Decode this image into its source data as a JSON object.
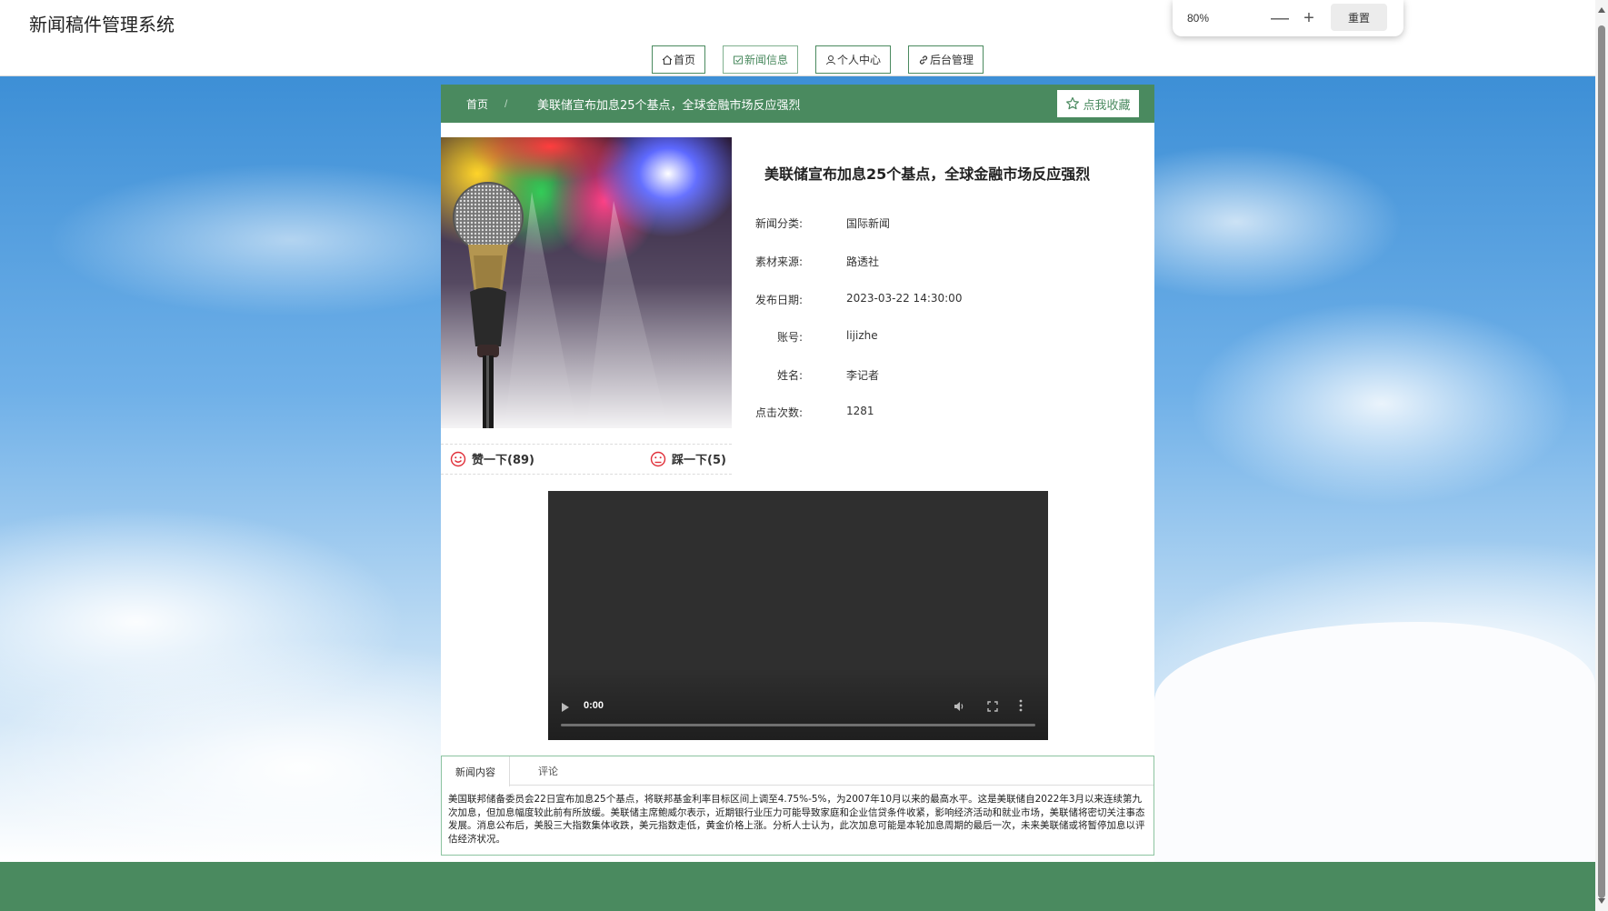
{
  "header": {
    "site_title": "新闻稿件管理系统",
    "nav": [
      {
        "label": "首页",
        "icon": "home-icon"
      },
      {
        "label": "新闻信息",
        "icon": "news-icon"
      },
      {
        "label": "个人中心",
        "icon": "user-icon"
      },
      {
        "label": "后台管理",
        "icon": "link-icon"
      }
    ]
  },
  "zoom": {
    "value": "80%",
    "minus": "—",
    "plus": "+",
    "reset_label": "重置"
  },
  "breadcrumb": {
    "home": "首页",
    "separator": "/",
    "current": "美联储宣布加息25个基点，全球金融市场反应强烈"
  },
  "favorite": {
    "label": "点我收藏",
    "icon": "star-icon"
  },
  "news": {
    "title": "美联储宣布加息25个基点，全球金融市场反应强烈",
    "fields": [
      {
        "label": "新闻分类:",
        "value": "国际新闻"
      },
      {
        "label": "素材来源:",
        "value": "路透社"
      },
      {
        "label": "发布日期:",
        "value": "2023-03-22 14:30:00"
      },
      {
        "label": "账号:",
        "value": "lijizhe"
      },
      {
        "label": "姓名:",
        "value": "李记者"
      },
      {
        "label": "点击次数:",
        "value": "1281"
      }
    ],
    "like_label": "赞一下(89)",
    "dislike_label": "踩一下(5)"
  },
  "video": {
    "time": "0:00",
    "progress": 0
  },
  "tabs": {
    "items": [
      "新闻内容",
      "评论"
    ],
    "active": "新闻内容",
    "content": "美国联邦储备委员会22日宣布加息25个基点，将联邦基金利率目标区间上调至4.75%-5%，为2007年10月以来的最高水平。这是美联储自2022年3月以来连续第九次加息，但加息幅度较此前有所放缓。美联储主席鲍威尔表示，近期银行业压力可能导致家庭和企业信贷条件收紧，影响经济活动和就业市场，美联储将密切关注事态发展。消息公布后，美股三大指数集体收跌，美元指数走低，黄金价格上涨。分析人士认为，此次加息可能是本轮加息周期的最后一次，未来美联储或将暂停加息以评估经济状况。"
  },
  "colors": {
    "primary_green": "#4a8a5f",
    "sky_blue": "#3d8fd6",
    "like_red": "#e0303a"
  }
}
